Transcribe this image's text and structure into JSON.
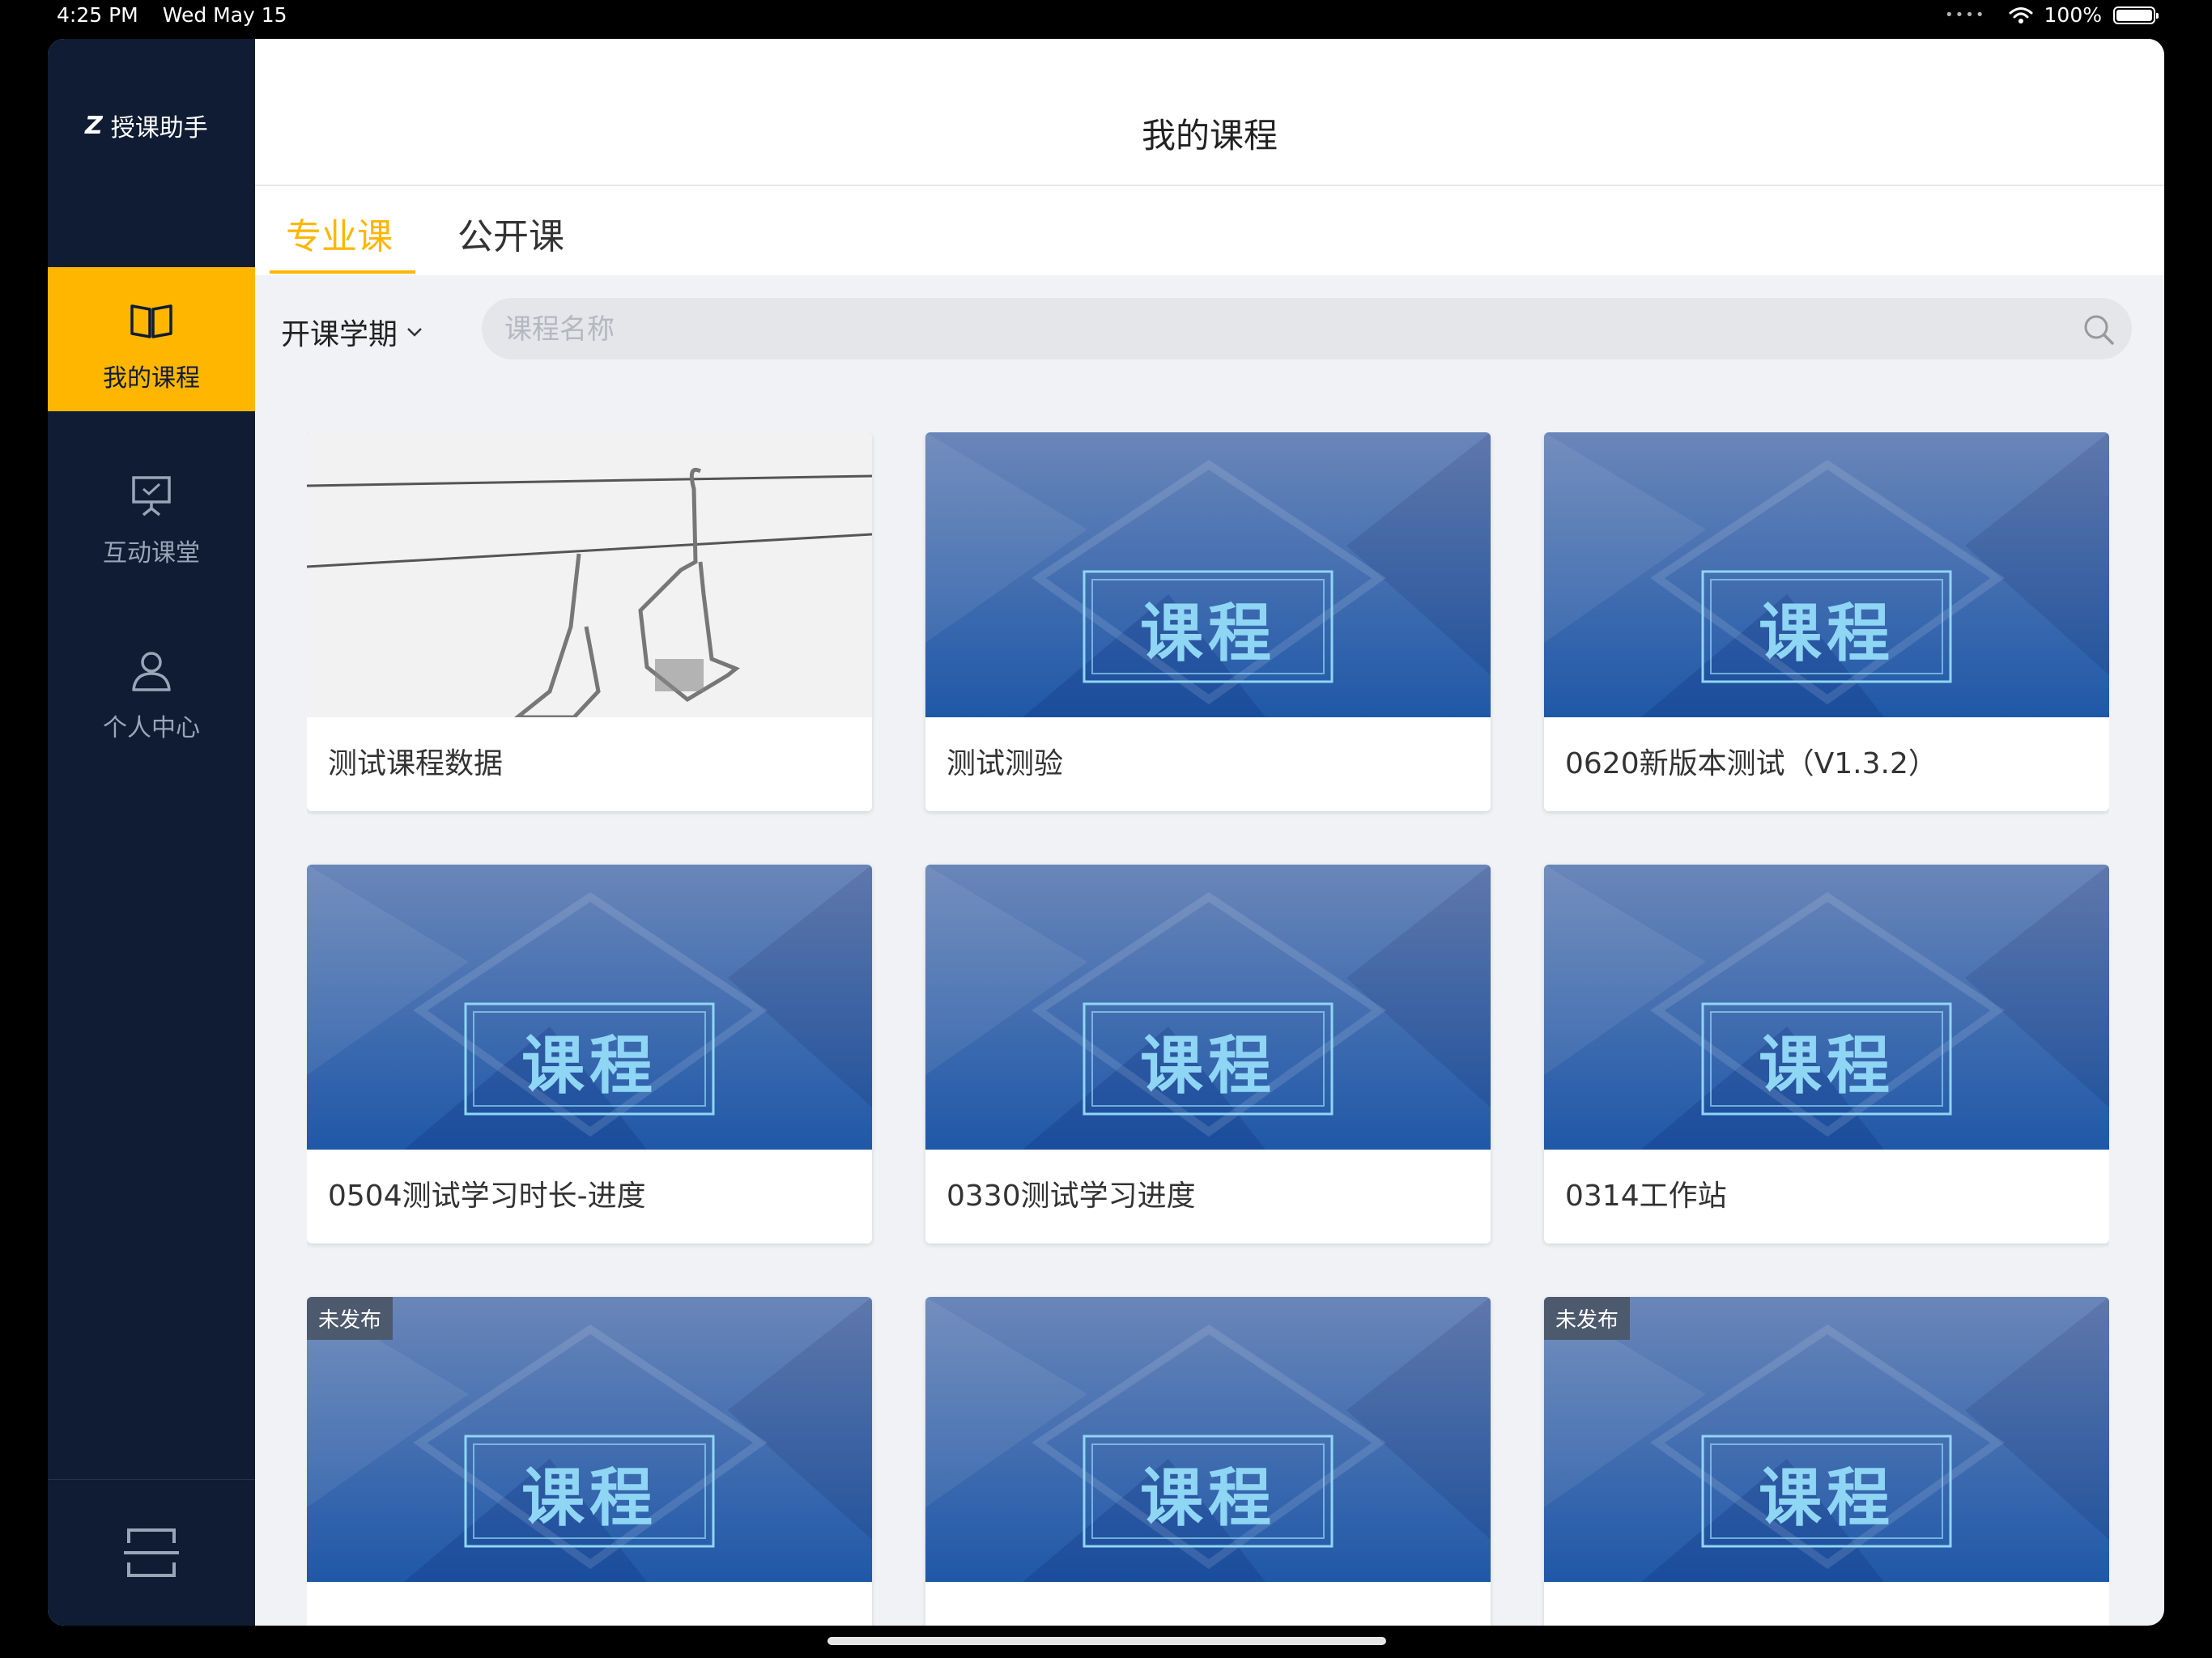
{
  "status_bar": {
    "time": "4:25 PM",
    "date": "Wed May 15",
    "battery": "100%"
  },
  "app": {
    "logo_mark": "Z",
    "name": "授课助手"
  },
  "sidebar": {
    "items": [
      {
        "label": "我的课程",
        "icon": "book-icon",
        "active": true
      },
      {
        "label": "互动课堂",
        "icon": "presentation-icon",
        "active": false
      },
      {
        "label": "个人中心",
        "icon": "person-icon",
        "active": false
      }
    ],
    "bottom_icon": "scan-icon"
  },
  "header": {
    "title": "我的课程"
  },
  "tabs": [
    {
      "label": "专业课",
      "active": true
    },
    {
      "label": "公开课",
      "active": false
    }
  ],
  "filter": {
    "label": "开课学期"
  },
  "search": {
    "placeholder": "课程名称",
    "value": ""
  },
  "cover_text": "课程",
  "courses": [
    {
      "title": "测试课程数据",
      "image": "photo",
      "badge": ""
    },
    {
      "title": "测试测验",
      "image": "cover",
      "badge": ""
    },
    {
      "title": "0620新版本测试（V1.3.2）",
      "image": "cover",
      "badge": ""
    },
    {
      "title": "0504测试学习时长-进度",
      "image": "cover",
      "badge": ""
    },
    {
      "title": "0330测试学习进度",
      "image": "cover",
      "badge": ""
    },
    {
      "title": "0314工作站",
      "image": "cover",
      "badge": ""
    },
    {
      "title": "",
      "image": "cover",
      "badge": "未发布"
    },
    {
      "title": "",
      "image": "cover",
      "badge": ""
    },
    {
      "title": "",
      "image": "cover",
      "badge": "未发布"
    }
  ],
  "colors": {
    "accent": "#ffb600",
    "sidebar": "#0f1c33",
    "cover_blue": "#2f5fa6",
    "cover_text": "#8fd6f5"
  }
}
